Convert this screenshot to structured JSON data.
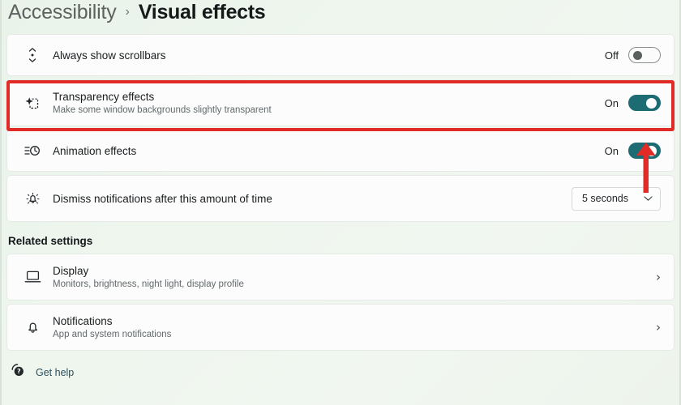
{
  "breadcrumb": {
    "root": "Accessibility",
    "separator": "›",
    "current": "Visual effects"
  },
  "settings": {
    "rows": [
      {
        "icon": "scrollbar-icon",
        "title": "Always show scrollbars",
        "subtitle": "",
        "control": "toggle",
        "state_label": "Off",
        "state": "off"
      },
      {
        "icon": "transparency-icon",
        "title": "Transparency effects",
        "subtitle": "Make some window backgrounds slightly transparent",
        "control": "toggle",
        "state_label": "On",
        "state": "on"
      },
      {
        "icon": "animation-icon",
        "title": "Animation effects",
        "subtitle": "",
        "control": "toggle",
        "state_label": "On",
        "state": "on"
      },
      {
        "icon": "notification-timer-icon",
        "title": "Dismiss notifications after this amount of time",
        "subtitle": "",
        "control": "dropdown",
        "value": "5 seconds"
      }
    ]
  },
  "related": {
    "header": "Related settings",
    "items": [
      {
        "icon": "monitor-icon",
        "title": "Display",
        "subtitle": "Monitors, brightness, night light, display profile",
        "chevron": "›"
      },
      {
        "icon": "bell-icon",
        "title": "Notifications",
        "subtitle": "App and system notifications",
        "chevron": "›"
      }
    ]
  },
  "footer": {
    "icon": "get-help-icon",
    "label": "Get help"
  },
  "annotations": {
    "highlight_color": "#e02b26",
    "arrow_color": "#e02b26",
    "highlight_target": "Transparency effects",
    "arrow_target": "Animation effects toggle"
  },
  "colors": {
    "toggle_on": "#1d6b73",
    "page_background": "#eef5ee",
    "card_background": "#fbfcfb"
  }
}
